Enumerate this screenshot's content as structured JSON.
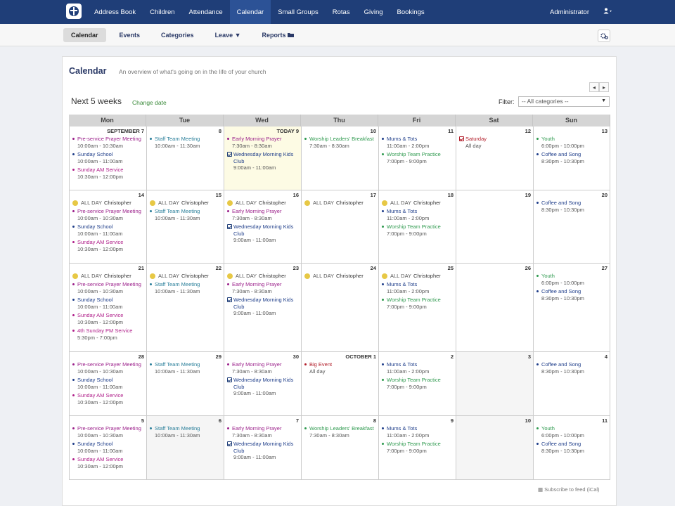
{
  "topnav": {
    "items": [
      "Address Book",
      "Children",
      "Attendance",
      "Calendar",
      "Small Groups",
      "Rotas",
      "Giving",
      "Bookings"
    ],
    "active": 3,
    "user": "Administrator"
  },
  "subnav": {
    "items": [
      {
        "label": "Calendar",
        "active": true
      },
      {
        "label": "Events"
      },
      {
        "label": "Categories"
      },
      {
        "label": "Leave ▼"
      },
      {
        "label": "Reports"
      }
    ]
  },
  "calendar": {
    "title": "Calendar",
    "description": "An overview of what's going on in the life of your church",
    "range_label": "Next 5 weeks",
    "change_date": "Change date",
    "filter_label": "Filter:",
    "filter_value": "-- All categories --",
    "days": [
      "Mon",
      "Tue",
      "Wed",
      "Thu",
      "Fri",
      "Sat",
      "Sun"
    ],
    "footer": "Subscribe to feed (iCal)"
  },
  "colors": {
    "purple": "#9b1f8a",
    "blue": "#1f3e8a",
    "teal": "#2a7f9a",
    "green": "#2f9a4f",
    "red": "#b21e2a",
    "magenta": "#b0208a"
  },
  "weeks": [
    [
      {
        "d": "SEPTEMBER 7",
        "events": [
          {
            "t": "Pre-service Prayer Meeting",
            "tm": "10:00am - 10:30am",
            "c": "purple"
          },
          {
            "t": "Sunday School",
            "tm": "10:00am - 11:00am",
            "c": "blue"
          },
          {
            "t": "Sunday AM Service",
            "tm": "10:30am - 12:00pm",
            "c": "magenta"
          }
        ]
      },
      {
        "d": "8",
        "events": [
          {
            "t": "Staff Team Meeting",
            "tm": "10:00am - 11:30am",
            "c": "teal"
          }
        ]
      },
      {
        "d": "TODAY 9",
        "today": true,
        "events": [
          {
            "t": "Early Morning Prayer",
            "tm": "7:30am - 8:30am",
            "c": "purple"
          },
          {
            "t": "Wednesday Morning Kids Club",
            "tm": "9:00am - 11:00am",
            "c": "blue",
            "check": true
          }
        ]
      },
      {
        "d": "10",
        "events": [
          {
            "t": "Worship Leaders' Breakfast",
            "tm": "7:30am - 8:30am",
            "c": "green"
          }
        ]
      },
      {
        "d": "11",
        "events": [
          {
            "t": "Mums & Tots",
            "tm": "11:00am - 2:00pm",
            "c": "blue"
          },
          {
            "t": "Worship Team Practice",
            "tm": "7:00pm - 9:00pm",
            "c": "green"
          }
        ]
      },
      {
        "d": "12",
        "events": [
          {
            "t": "Saturday",
            "tm": "All day",
            "c": "red",
            "check": true,
            "checkred": true
          }
        ]
      },
      {
        "d": "13",
        "events": [
          {
            "t": "Youth",
            "tm": "6:00pm - 10:00pm",
            "c": "green"
          },
          {
            "t": "Coffee and Song",
            "tm": "8:30pm - 10:30pm",
            "c": "blue"
          }
        ]
      }
    ],
    [
      {
        "d": "14",
        "allday": "Christopher",
        "events": [
          {
            "t": "Pre-service Prayer Meeting",
            "tm": "10:00am - 10:30am",
            "c": "purple"
          },
          {
            "t": "Sunday School",
            "tm": "10:00am - 11:00am",
            "c": "blue"
          },
          {
            "t": "Sunday AM Service",
            "tm": "10:30am - 12:00pm",
            "c": "magenta"
          }
        ]
      },
      {
        "d": "15",
        "allday": "Christopher",
        "events": [
          {
            "t": "Staff Team Meeting",
            "tm": "10:00am - 11:30am",
            "c": "teal"
          }
        ]
      },
      {
        "d": "16",
        "allday": "Christopher",
        "events": [
          {
            "t": "Early Morning Prayer",
            "tm": "7:30am - 8:30am",
            "c": "purple"
          },
          {
            "t": "Wednesday Morning Kids Club",
            "tm": "9:00am - 11:00am",
            "c": "blue",
            "check": true
          }
        ]
      },
      {
        "d": "17",
        "allday": "Christopher",
        "events": []
      },
      {
        "d": "18",
        "allday": "Christopher",
        "events": [
          {
            "t": "Mums & Tots",
            "tm": "11:00am - 2:00pm",
            "c": "blue"
          },
          {
            "t": "Worship Team Practice",
            "tm": "7:00pm - 9:00pm",
            "c": "green"
          }
        ]
      },
      {
        "d": "19",
        "events": []
      },
      {
        "d": "20",
        "events": [
          {
            "t": "Coffee and Song",
            "tm": "8:30pm - 10:30pm",
            "c": "blue"
          }
        ]
      }
    ],
    [
      {
        "d": "21",
        "allday": "Christopher",
        "events": [
          {
            "t": "Pre-service Prayer Meeting",
            "tm": "10:00am - 10:30am",
            "c": "purple"
          },
          {
            "t": "Sunday School",
            "tm": "10:00am - 11:00am",
            "c": "blue"
          },
          {
            "t": "Sunday AM Service",
            "tm": "10:30am - 12:00pm",
            "c": "magenta"
          },
          {
            "t": "4th Sunday PM Service",
            "tm": "5:30pm - 7:00pm",
            "c": "magenta"
          }
        ]
      },
      {
        "d": "22",
        "allday": "Christopher",
        "events": [
          {
            "t": "Staff Team Meeting",
            "tm": "10:00am - 11:30am",
            "c": "teal"
          }
        ]
      },
      {
        "d": "23",
        "allday": "Christopher",
        "events": [
          {
            "t": "Early Morning Prayer",
            "tm": "7:30am - 8:30am",
            "c": "purple"
          },
          {
            "t": "Wednesday Morning Kids Club",
            "tm": "9:00am - 11:00am",
            "c": "blue",
            "check": true
          }
        ]
      },
      {
        "d": "24",
        "allday": "Christopher",
        "events": []
      },
      {
        "d": "25",
        "allday": "Christopher",
        "events": [
          {
            "t": "Mums & Tots",
            "tm": "11:00am - 2:00pm",
            "c": "blue"
          },
          {
            "t": "Worship Team Practice",
            "tm": "7:00pm - 9:00pm",
            "c": "green"
          }
        ]
      },
      {
        "d": "26",
        "events": []
      },
      {
        "d": "27",
        "events": [
          {
            "t": "Youth",
            "tm": "6:00pm - 10:00pm",
            "c": "green"
          },
          {
            "t": "Coffee and Song",
            "tm": "8:30pm - 10:30pm",
            "c": "blue"
          }
        ]
      }
    ],
    [
      {
        "d": "28",
        "events": [
          {
            "t": "Pre-service Prayer Meeting",
            "tm": "10:00am - 10:30am",
            "c": "purple"
          },
          {
            "t": "Sunday School",
            "tm": "10:00am - 11:00am",
            "c": "blue"
          },
          {
            "t": "Sunday AM Service",
            "tm": "10:30am - 12:00pm",
            "c": "magenta"
          }
        ]
      },
      {
        "d": "29",
        "events": [
          {
            "t": "Staff Team Meeting",
            "tm": "10:00am - 11:30am",
            "c": "teal"
          }
        ]
      },
      {
        "d": "30",
        "events": [
          {
            "t": "Early Morning Prayer",
            "tm": "7:30am - 8:30am",
            "c": "purple"
          },
          {
            "t": "Wednesday Morning Kids Club",
            "tm": "9:00am - 11:00am",
            "c": "blue",
            "check": true
          }
        ]
      },
      {
        "d": "OCTOBER 1",
        "events": [
          {
            "t": "Big Event",
            "tm": "All day",
            "c": "red"
          }
        ]
      },
      {
        "d": "2",
        "events": [
          {
            "t": "Mums & Tots",
            "tm": "11:00am - 2:00pm",
            "c": "blue"
          },
          {
            "t": "Worship Team Practice",
            "tm": "7:00pm - 9:00pm",
            "c": "green"
          }
        ]
      },
      {
        "d": "3",
        "shaded": true,
        "events": []
      },
      {
        "d": "4",
        "events": [
          {
            "t": "Coffee and Song",
            "tm": "8:30pm - 10:30pm",
            "c": "blue"
          }
        ]
      }
    ],
    [
      {
        "d": "5",
        "events": [
          {
            "t": "Pre-service Prayer Meeting",
            "tm": "10:00am - 10:30am",
            "c": "purple"
          },
          {
            "t": "Sunday School",
            "tm": "10:00am - 11:00am",
            "c": "blue"
          },
          {
            "t": "Sunday AM Service",
            "tm": "10:30am - 12:00pm",
            "c": "magenta"
          }
        ]
      },
      {
        "d": "6",
        "shaded": true,
        "events": [
          {
            "t": "Staff Team Meeting",
            "tm": "10:00am - 11:30am",
            "c": "teal"
          }
        ]
      },
      {
        "d": "7",
        "events": [
          {
            "t": "Early Morning Prayer",
            "tm": "7:30am - 8:30am",
            "c": "purple"
          },
          {
            "t": "Wednesday Morning Kids Club",
            "tm": "9:00am - 11:00am",
            "c": "blue",
            "check": true
          }
        ]
      },
      {
        "d": "8",
        "events": [
          {
            "t": "Worship Leaders' Breakfast",
            "tm": "7:30am - 8:30am",
            "c": "green"
          }
        ]
      },
      {
        "d": "9",
        "events": [
          {
            "t": "Mums & Tots",
            "tm": "11:00am - 2:00pm",
            "c": "blue"
          },
          {
            "t": "Worship Team Practice",
            "tm": "7:00pm - 9:00pm",
            "c": "green"
          }
        ]
      },
      {
        "d": "10",
        "shaded": true,
        "events": []
      },
      {
        "d": "11",
        "events": [
          {
            "t": "Youth",
            "tm": "6:00pm - 10:00pm",
            "c": "green"
          },
          {
            "t": "Coffee and Song",
            "tm": "8:30pm - 10:30pm",
            "c": "blue"
          }
        ]
      }
    ]
  ],
  "allday_prefix": "ALL DAY"
}
